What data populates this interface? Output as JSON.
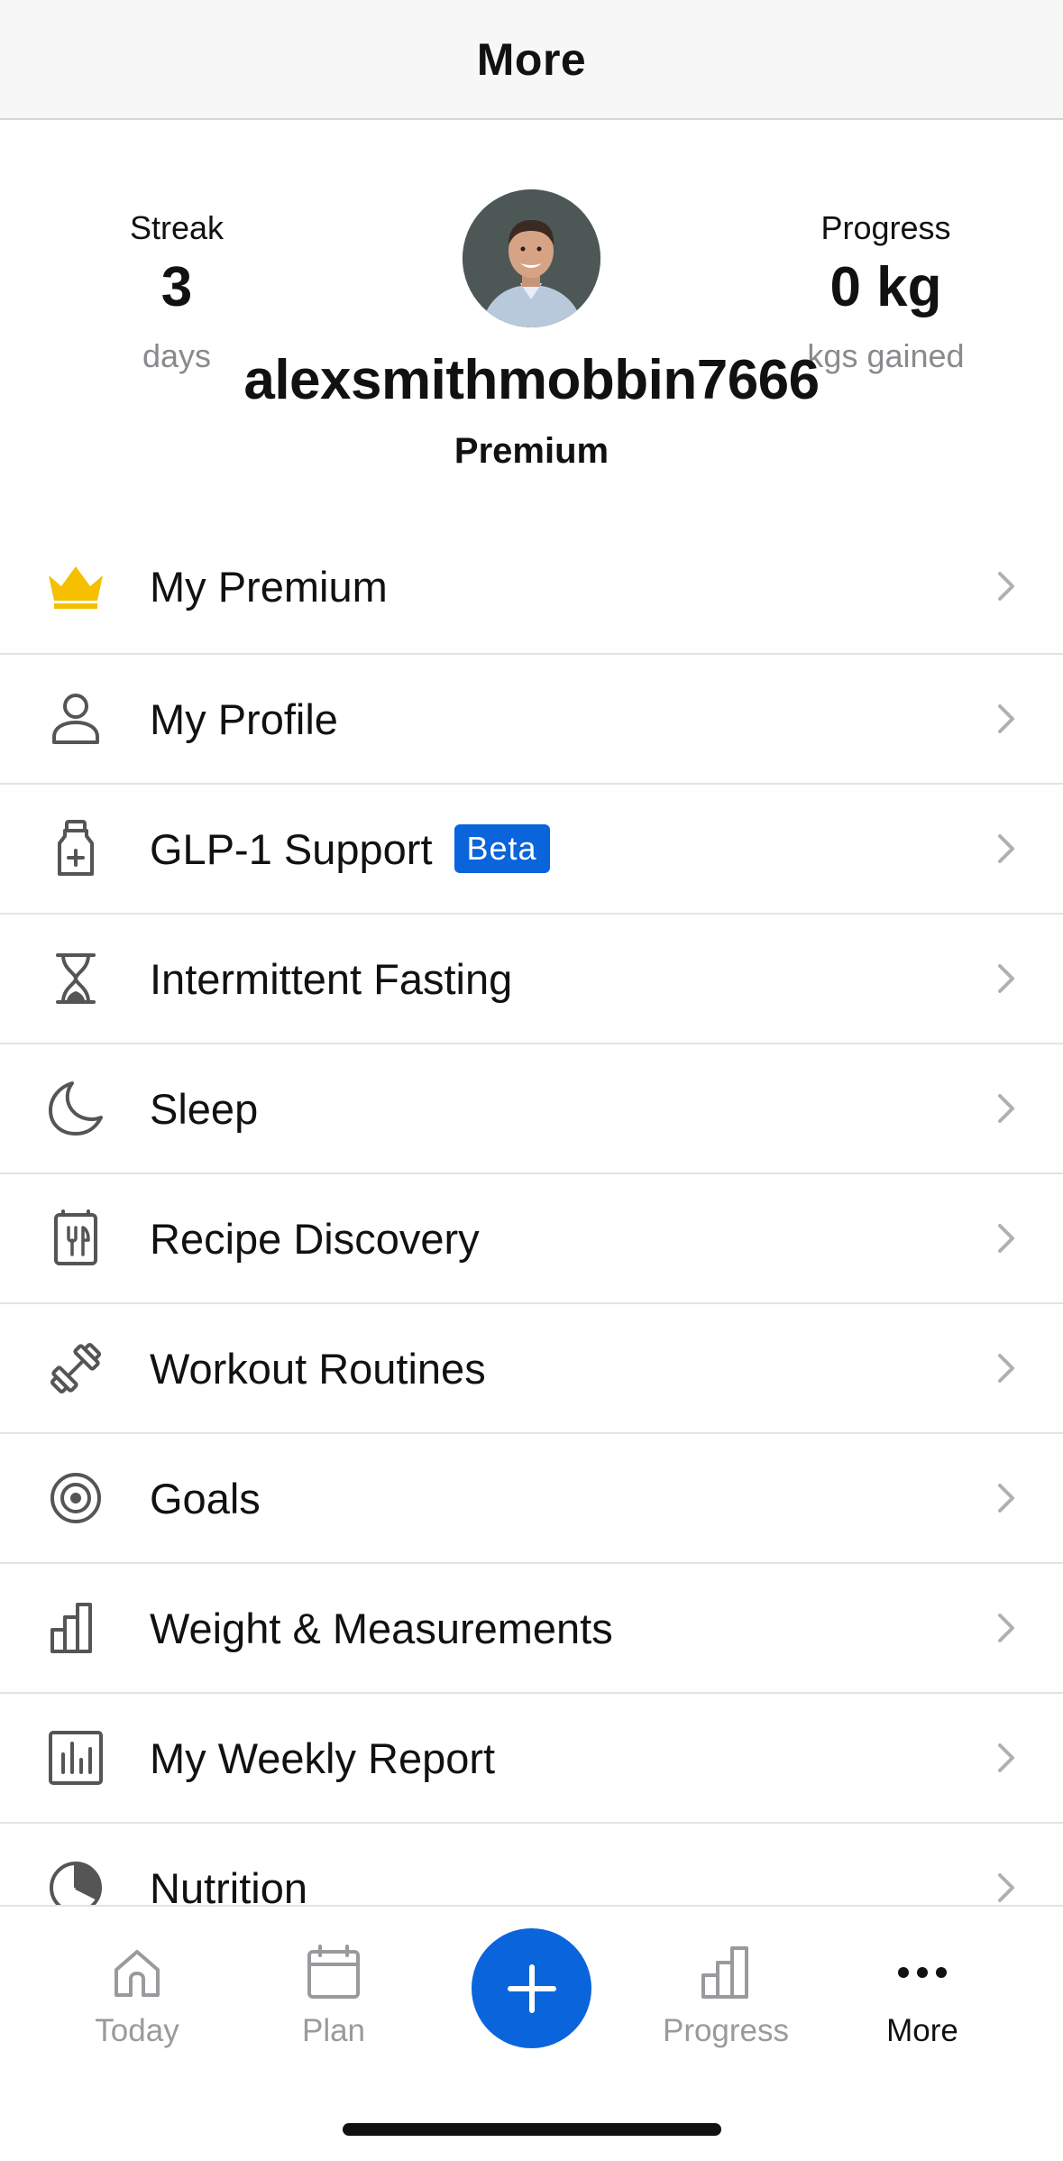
{
  "nav": {
    "title": "More"
  },
  "header": {
    "streak": {
      "label": "Streak",
      "value": "3",
      "unit": "days"
    },
    "progress": {
      "label": "Progress",
      "value": "0 kg",
      "unit": "kgs gained"
    },
    "username": "alexsmithmobbin7666",
    "tier": "Premium"
  },
  "menu": [
    {
      "label": "My Premium",
      "icon": "crown-icon"
    },
    {
      "label": "My Profile",
      "icon": "person-icon"
    },
    {
      "label": "GLP-1 Support",
      "icon": "medicine-bottle-icon",
      "badge": "Beta"
    },
    {
      "label": "Intermittent Fasting",
      "icon": "hourglass-icon"
    },
    {
      "label": "Sleep",
      "icon": "moon-icon"
    },
    {
      "label": "Recipe Discovery",
      "icon": "recipe-book-icon"
    },
    {
      "label": "Workout Routines",
      "icon": "dumbbell-icon"
    },
    {
      "label": "Goals",
      "icon": "target-icon"
    },
    {
      "label": "Weight & Measurements",
      "icon": "bar-chart-icon"
    },
    {
      "label": "My Weekly Report",
      "icon": "report-icon"
    },
    {
      "label": "Nutrition",
      "icon": "pie-chart-icon"
    }
  ],
  "tabs": {
    "today": "Today",
    "plan": "Plan",
    "progress": "Progress",
    "more": "More",
    "active": "More"
  },
  "colors": {
    "accent": "#0a64dc",
    "crown": "#f5c000",
    "icon_gray": "#555555",
    "chevron": "#b0b0b4"
  }
}
